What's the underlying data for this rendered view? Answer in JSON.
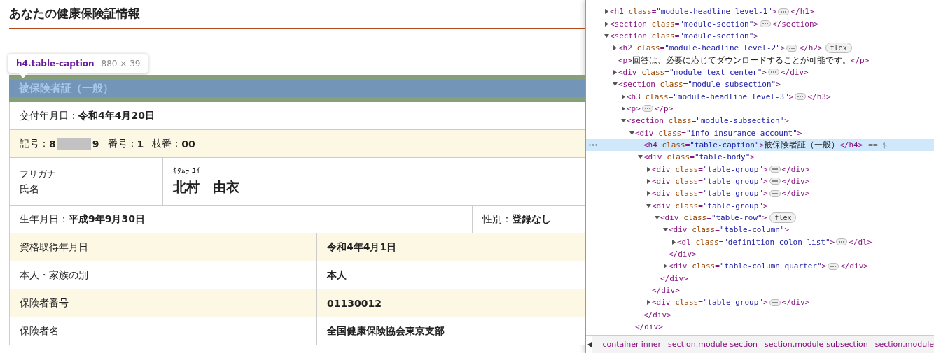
{
  "page": {
    "title": "あなたの健康保険証情報",
    "tooltip": {
      "selector": "h4.table-caption",
      "size": "880 × 39"
    },
    "caption": "被保険者証（一般）",
    "rows": [
      {
        "kind": "single",
        "shade": false,
        "text": "交付年月日：**令和4年4月20日**"
      },
      {
        "kind": "codes",
        "shade": true,
        "items": [
          {
            "label": "記号：",
            "value": "8",
            "redacted": true,
            "value_after": "9"
          },
          {
            "label": "番号：",
            "value": "1",
            "redacted": false
          },
          {
            "label": "枝番：",
            "value": "00",
            "redacted": false
          }
        ]
      },
      {
        "kind": "name",
        "shade": false,
        "label_kana": "フリガナ",
        "label": "氏名",
        "kana": "ｷﾀﾑﾗ ﾕｲ",
        "name": "北村　由衣"
      },
      {
        "kind": "split",
        "shade": false,
        "left": "生年月日：**平成9年9月30日**",
        "right": "性別：**登録なし**"
      },
      {
        "kind": "pair",
        "shade": true,
        "label": "資格取得年月日",
        "value": "令和4年4月1日"
      },
      {
        "kind": "pair",
        "shade": false,
        "label": "本人・家族の別",
        "value": "本人"
      },
      {
        "kind": "pair",
        "shade": true,
        "label": "保険者番号",
        "value": "01130012"
      },
      {
        "kind": "pair",
        "shade": false,
        "label": "保険者名",
        "value": "全国健康保険協会東京支部"
      }
    ]
  },
  "devtools": {
    "tree": [
      {
        "open": "<h1 class=\"module-headline level-1\">",
        "close": "</h1>",
        "expanded": false,
        "selected": false
      },
      {
        "open": "<section class=\"module-section\">",
        "close": "</section>",
        "expanded": false,
        "selected": false
      },
      {
        "open": "<section class=\"module-section\">",
        "expanded": true,
        "selected": false,
        "children": [
          {
            "open": "<h2 class=\"module-headline level-2\">",
            "close": "</h2>",
            "badge": "flex",
            "expanded": false,
            "selected": false
          },
          {
            "open": "<p>",
            "text": "回答は、必要に応じてダウンロードすることが可能です。",
            "close": "</p>",
            "selected": false
          },
          {
            "open": "<div class=\"module-text-center\">",
            "close": "</div>",
            "expanded": false,
            "selected": false
          },
          {
            "open": "<section class=\"module-subsection\">",
            "expanded": true,
            "selected": false,
            "children": [
              {
                "open": "<h3 class=\"module-headline level-3\">",
                "close": "</h3>",
                "expanded": false,
                "selected": false
              },
              {
                "open": "<p>",
                "close": "</p>",
                "expanded": false,
                "selected": false
              },
              {
                "open": "<section class=\"module-subsection\">",
                "expanded": true,
                "selected": false,
                "children": [
                  {
                    "open": "<div class=\"info-insurance-account\">",
                    "close": "</div>",
                    "expanded": true,
                    "selected": false,
                    "children": [
                      {
                        "open": "<h4 class=\"table-caption\">",
                        "text": "被保険者証（一般）",
                        "close": "</h4>",
                        "suffix": "== $",
                        "selected": true
                      },
                      {
                        "open": "<div class=\"table-body\">",
                        "close": "</div>",
                        "expanded": true,
                        "selected": false,
                        "children": [
                          {
                            "open": "<div class=\"table-group\">",
                            "close": "</div>",
                            "expanded": false,
                            "selected": false
                          },
                          {
                            "open": "<div class=\"table-group\">",
                            "close": "</div>",
                            "expanded": false,
                            "selected": false
                          },
                          {
                            "open": "<div class=\"table-group\">",
                            "close": "</div>",
                            "expanded": false,
                            "selected": false
                          },
                          {
                            "open": "<div class=\"table-group\">",
                            "close": "</div>",
                            "expanded": true,
                            "selected": false,
                            "children": [
                              {
                                "open": "<div class=\"table-row\">",
                                "close": "</div>",
                                "badge": "flex",
                                "expanded": true,
                                "selected": false,
                                "children": [
                                  {
                                    "open": "<div class=\"table-column\">",
                                    "close": "</div>",
                                    "expanded": true,
                                    "selected": false,
                                    "children": [
                                      {
                                        "open": "<dl class=\"definition-colon-list\">",
                                        "close": "</dl>",
                                        "expanded": false,
                                        "selected": false
                                      }
                                    ]
                                  },
                                  {
                                    "open": "<div class=\"table-column quarter\">",
                                    "close": "</div>",
                                    "expanded": false,
                                    "selected": false
                                  }
                                ]
                              }
                            ]
                          },
                          {
                            "open": "<div class=\"table-group\">",
                            "close": "</div>",
                            "expanded": false,
                            "selected": false
                          }
                        ]
                      }
                    ]
                  }
                ]
              }
            ]
          }
        ]
      }
    ],
    "breadcrumbs": [
      "-container-inner",
      "section.module-section",
      "section.module-subsection",
      "section.module"
    ]
  }
}
